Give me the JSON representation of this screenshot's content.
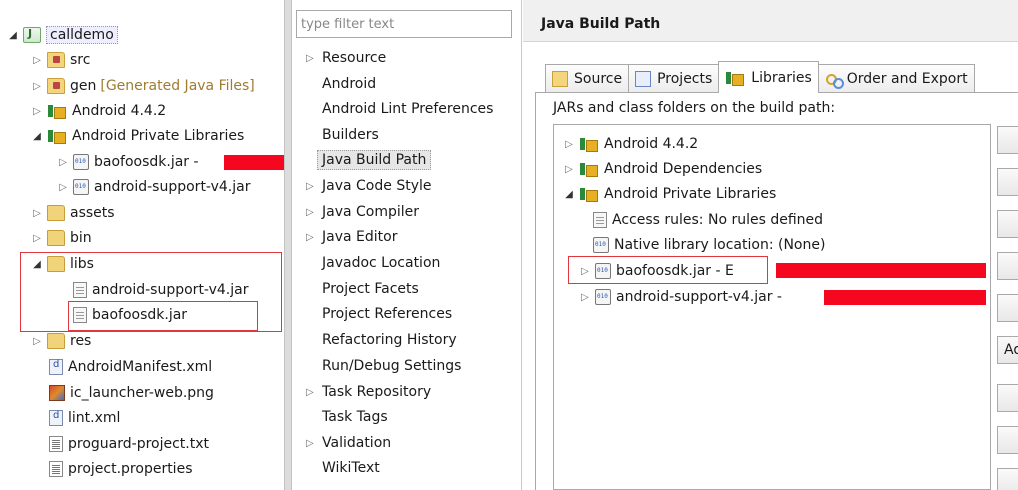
{
  "explorer": {
    "items": [
      {
        "arrow": "◢",
        "icon": "project-icon",
        "label": "calldemo",
        "extra": ""
      },
      {
        "arrow": "▷",
        "icon": "source-folder-icon",
        "label": "src",
        "extra": ""
      },
      {
        "arrow": "▷",
        "icon": "source-folder-icon",
        "label": "gen",
        "extra": "[Generated Java Files]"
      },
      {
        "arrow": "▷",
        "icon": "library-icon",
        "label": "Android 4.4.2",
        "extra": ""
      },
      {
        "arrow": "◢",
        "icon": "library-icon",
        "label": "Android Private Libraries",
        "extra": ""
      },
      {
        "arrow": "▷",
        "icon": "jar-icon",
        "label": "baofoosdk.jar -",
        "extra": ""
      },
      {
        "arrow": "▷",
        "icon": "jar-icon",
        "label": "android-support-v4.jar",
        "extra": ""
      },
      {
        "arrow": "▷",
        "icon": "folder-icon",
        "label": "assets",
        "extra": ""
      },
      {
        "arrow": "▷",
        "icon": "folder-icon",
        "label": "bin",
        "extra": ""
      },
      {
        "arrow": "◢",
        "icon": "folder-icon",
        "label": "libs",
        "extra": ""
      },
      {
        "arrow": "",
        "icon": "file-icon",
        "label": "android-support-v4.jar",
        "extra": ""
      },
      {
        "arrow": "",
        "icon": "file-icon",
        "label": "baofoosdk.jar",
        "extra": ""
      },
      {
        "arrow": "▷",
        "icon": "folder-icon",
        "label": "res",
        "extra": ""
      },
      {
        "arrow": "",
        "icon": "xml-icon",
        "label": "AndroidManifest.xml",
        "extra": ""
      },
      {
        "arrow": "",
        "icon": "image-icon",
        "label": "ic_launcher-web.png",
        "extra": ""
      },
      {
        "arrow": "",
        "icon": "xml-icon",
        "label": "lint.xml",
        "extra": ""
      },
      {
        "arrow": "",
        "icon": "text-file-icon",
        "label": "proguard-project.txt",
        "extra": ""
      },
      {
        "arrow": "",
        "icon": "text-file-icon",
        "label": "project.properties",
        "extra": ""
      }
    ]
  },
  "nav": {
    "filter_placeholder": "type filter text",
    "items": [
      {
        "arrow": "▷",
        "label": "Resource"
      },
      {
        "arrow": "",
        "label": "Android"
      },
      {
        "arrow": "",
        "label": "Android Lint Preferences"
      },
      {
        "arrow": "",
        "label": "Builders"
      },
      {
        "arrow": "",
        "label": "Java Build Path"
      },
      {
        "arrow": "▷",
        "label": "Java Code Style"
      },
      {
        "arrow": "▷",
        "label": "Java Compiler"
      },
      {
        "arrow": "▷",
        "label": "Java Editor"
      },
      {
        "arrow": "",
        "label": "Javadoc Location"
      },
      {
        "arrow": "",
        "label": "Project Facets"
      },
      {
        "arrow": "",
        "label": "Project References"
      },
      {
        "arrow": "",
        "label": "Refactoring History"
      },
      {
        "arrow": "",
        "label": "Run/Debug Settings"
      },
      {
        "arrow": "▷",
        "label": "Task Repository"
      },
      {
        "arrow": "",
        "label": "Task Tags"
      },
      {
        "arrow": "▷",
        "label": "Validation"
      },
      {
        "arrow": "",
        "label": "WikiText"
      }
    ]
  },
  "page": {
    "title": "Java Build Path",
    "tabs": [
      {
        "label": "Source",
        "icon": "source-tab-icon"
      },
      {
        "label": "Projects",
        "icon": "projects-tab-icon"
      },
      {
        "label": "Libraries",
        "icon": "libraries-tab-icon"
      },
      {
        "label": "Order and Export",
        "icon": "order-export-tab-icon"
      }
    ],
    "jars_label": "JARs and class folders on the build path:",
    "libs": [
      {
        "arrow": "▷",
        "icon": "library-icon",
        "label": "Android 4.4.2"
      },
      {
        "arrow": "▷",
        "icon": "library-icon",
        "label": "Android Dependencies"
      },
      {
        "arrow": "◢",
        "icon": "library-icon",
        "label": "Android Private Libraries"
      },
      {
        "arrow": "",
        "icon": "access-rules-icon",
        "label": "Access rules: No rules defined"
      },
      {
        "arrow": "",
        "icon": "native-library-icon",
        "label": "Native library location: (None)"
      },
      {
        "arrow": "▷",
        "icon": "jar-icon",
        "label": "baofoosdk.jar - E"
      },
      {
        "arrow": "▷",
        "icon": "jar-icon",
        "label": "android-support-v4.jar -"
      }
    ],
    "side_button_partial": "Ad"
  }
}
